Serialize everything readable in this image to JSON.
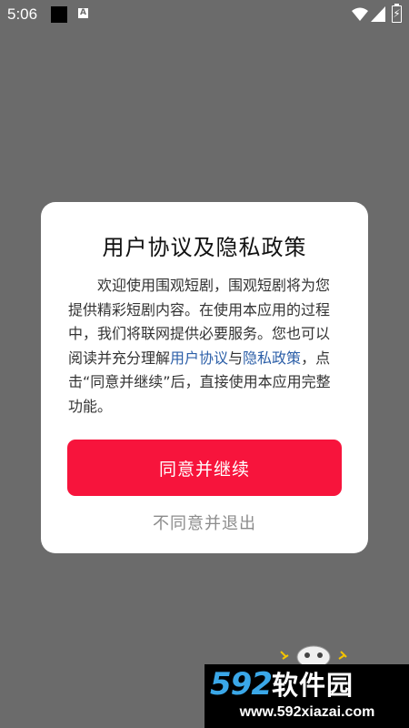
{
  "status_bar": {
    "time": "5:06",
    "notification_icon": "A"
  },
  "dialog": {
    "title": "用户协议及隐私政策",
    "body_part1": "欢迎使用围观短剧，围观短剧将为您提供精彩短剧内容。在使用本应用的过程中，我们将联网提供必要服务。您也可以阅读并充分理解",
    "user_agreement_link": "用户协议",
    "body_and": "与",
    "privacy_policy_link": "隐私政策",
    "body_part2": "，点击“同意并继续”后，直接使用本应用完整功能。",
    "agree_button": "同意并继续",
    "disagree_button": "不同意并退出"
  },
  "watermark": {
    "brand_number": "592",
    "brand_text": "软件园",
    "url": "www.592xiazai.com"
  },
  "colors": {
    "overlay": "#6b6b6b",
    "accent": "#f7143c",
    "link": "#2c5fa8"
  }
}
